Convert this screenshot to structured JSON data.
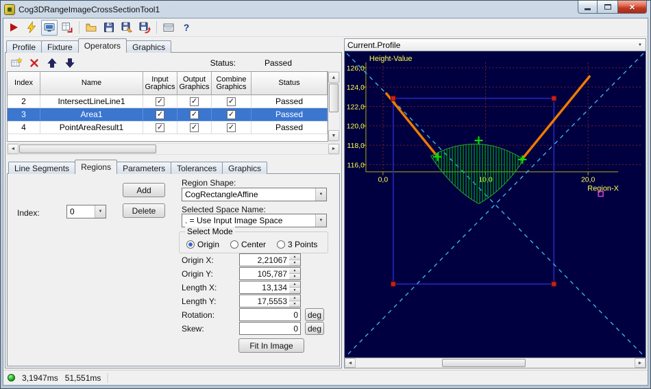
{
  "window": {
    "title": "Cog3DRangeImageCrossSectionTool1"
  },
  "icons": {
    "check": "✓",
    "dropdown": "▼",
    "close": "×",
    "help": "?",
    "spin_up": "▲",
    "spin_down": "▼",
    "scroll_up": "▲",
    "scroll_down": "▼",
    "scroll_left": "◄",
    "scroll_right": "►"
  },
  "main_tabs": {
    "items": [
      {
        "label": "Profile"
      },
      {
        "label": "Fixture"
      },
      {
        "label": "Operators"
      },
      {
        "label": "Graphics"
      }
    ]
  },
  "operator_toolbar": {
    "status_label": "Status:",
    "status_value": "Passed"
  },
  "grid": {
    "headers": {
      "index": "Index",
      "name": "Name",
      "input": "Input Graphics",
      "output": "Output Graphics",
      "combine": "Combine Graphics",
      "status": "Status"
    },
    "rows": [
      {
        "index": "2",
        "name": "IntersectLineLine1",
        "input": true,
        "output": true,
        "combine": true,
        "status": "Passed",
        "selected": false
      },
      {
        "index": "3",
        "name": "Area1",
        "input": true,
        "output": true,
        "combine": true,
        "status": "Passed",
        "selected": true
      },
      {
        "index": "4",
        "name": "PointAreaResult1",
        "input": true,
        "output": true,
        "combine": true,
        "status": "Passed",
        "selected": false
      }
    ]
  },
  "sub_tabs": {
    "items": [
      {
        "label": "Line Segments"
      },
      {
        "label": "Regions"
      },
      {
        "label": "Parameters"
      },
      {
        "label": "Tolerances"
      },
      {
        "label": "Graphics"
      }
    ]
  },
  "regions": {
    "index_label": "Index:",
    "index_value": "0",
    "add_label": "Add",
    "delete_label": "Delete",
    "shape_label": "Region Shape:",
    "shape_value": "CogRectangleAffine",
    "space_label": "Selected Space Name:",
    "space_value": ". = Use Input Image Space",
    "mode_label": "Select Mode",
    "modes": [
      {
        "label": "Origin",
        "selected": true
      },
      {
        "label": "Center",
        "selected": false
      },
      {
        "label": "3 Points",
        "selected": false
      }
    ],
    "fields": [
      {
        "label": "Origin X:",
        "value": "2,21067"
      },
      {
        "label": "Origin Y:",
        "value": "105,787"
      },
      {
        "label": "Length X:",
        "value": "13,134"
      },
      {
        "label": "Length Y:",
        "value": "17,5553"
      },
      {
        "label": "Rotation:",
        "value": "0",
        "unit": "deg"
      },
      {
        "label": "Skew:",
        "value": "0",
        "unit": "deg"
      }
    ],
    "fit_label": "Fit In Image"
  },
  "display": {
    "header": "Current.Profile",
    "y_axis_label": "Height-Value",
    "x_axis_label": "Region-X",
    "y_ticks": [
      "126,0",
      "124,0",
      "122,0",
      "120,0",
      "118,0",
      "116,0"
    ],
    "x_ticks": [
      "0,0",
      "10,0",
      "20,0"
    ]
  },
  "chart_data": {
    "type": "line",
    "title": "Current.Profile",
    "xlabel": "Region-X",
    "ylabel": "Height-Value",
    "xlim": [
      0,
      25
    ],
    "ylim": [
      116,
      126
    ],
    "x_ticks": [
      0,
      10,
      20
    ],
    "y_ticks": [
      126,
      124,
      122,
      120,
      118,
      116
    ],
    "series": [
      {
        "name": "profile-left-segment",
        "color": "#f07a00",
        "x": [
          0.3,
          5.3
        ],
        "y": [
          123.3,
          116.8
        ]
      },
      {
        "name": "profile-right-segment",
        "color": "#f07a00",
        "x": [
          13.6,
          20.1
        ],
        "y": [
          116.5,
          125.1
        ]
      }
    ],
    "markers": [
      {
        "name": "vertex-left",
        "x": 5.3,
        "y": 116.8,
        "color": "#00e000"
      },
      {
        "name": "vertex-top",
        "x": 9.3,
        "y": 118.5,
        "color": "#00e000"
      },
      {
        "name": "vertex-right",
        "x": 13.6,
        "y": 116.5,
        "color": "#00e000"
      },
      {
        "name": "point-marker",
        "x": 21.2,
        "y": 113.0,
        "color": "#e040e0"
      }
    ],
    "annotations": [
      "hatched-area-region",
      "affine-rectangle-region-with-corner-handles",
      "dashed-diagonal-crosshairs"
    ]
  },
  "statusbar": {
    "time1": "3,1947ms",
    "time2": "51,551ms"
  }
}
